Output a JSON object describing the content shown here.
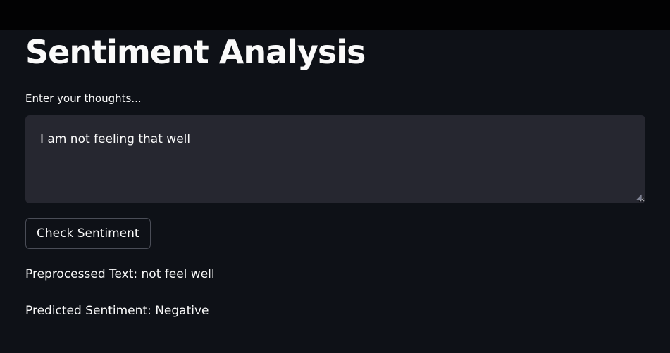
{
  "page": {
    "title": "Sentiment Analysis"
  },
  "input": {
    "label": "Enter your thoughts...",
    "value": "I am not feeling that well"
  },
  "actions": {
    "check_label": "Check Sentiment"
  },
  "results": {
    "preprocessed": "Preprocessed Text: not feel well",
    "predicted": "Predicted Sentiment: Negative"
  },
  "colors": {
    "background": "#0e1117",
    "header": "#020203",
    "input_bg": "#262730",
    "text": "#fafafa"
  }
}
